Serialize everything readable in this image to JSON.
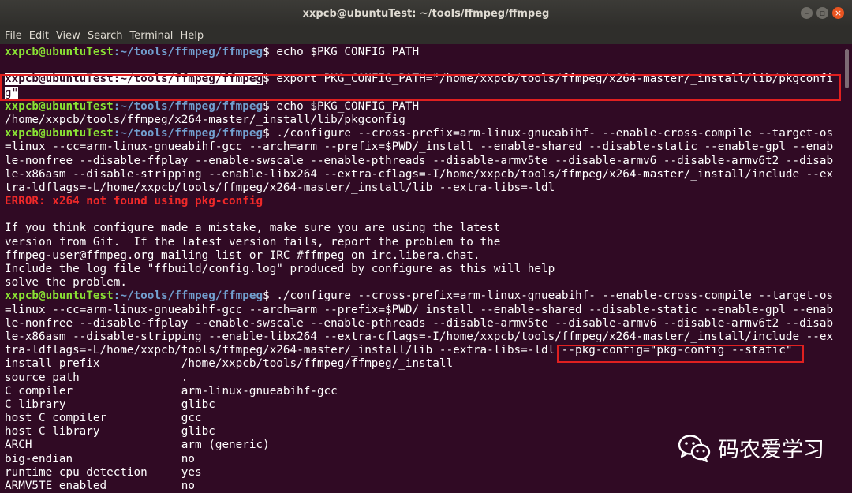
{
  "window": {
    "title": "xxpcb@ubuntuTest: ~/tools/ffmpeg/ffmpeg"
  },
  "menu": [
    "File",
    "Edit",
    "View",
    "Search",
    "Terminal",
    "Help"
  ],
  "prompt": {
    "user": "xxpcb@ubuntuTest",
    "path": ":~/tools/ffmpeg/ffmpeg"
  },
  "lines": [
    {
      "type": "cmd",
      "text": "$ echo $PKG_CONFIG_PATH"
    },
    {
      "type": "blank",
      "text": ""
    },
    {
      "type": "cmd_sel",
      "text": "$ export PKG_CONFIG_PATH=\"/home/xxpcb/tools/ffmpeg/x264-master/_install/lib/pkgconfi"
    },
    {
      "type": "sel",
      "text": "g\""
    },
    {
      "type": "cmd",
      "text": "$ echo $PKG_CONFIG_PATH"
    },
    {
      "type": "out",
      "text": "/home/xxpcb/tools/ffmpeg/x264-master/_install/lib/pkgconfig"
    },
    {
      "type": "cmd",
      "text": "$ ./configure --cross-prefix=arm-linux-gnueabihf- --enable-cross-compile --target-os"
    },
    {
      "type": "out",
      "text": "=linux --cc=arm-linux-gnueabihf-gcc --arch=arm --prefix=$PWD/_install --enable-shared --disable-static --enable-gpl --enab"
    },
    {
      "type": "out",
      "text": "le-nonfree --disable-ffplay --enable-swscale --enable-pthreads --disable-armv5te --disable-armv6 --disable-armv6t2 --disab"
    },
    {
      "type": "out",
      "text": "le-x86asm --disable-stripping --enable-libx264 --extra-cflags=-I/home/xxpcb/tools/ffmpeg/x264-master/_install/include --ex"
    },
    {
      "type": "out",
      "text": "tra-ldflags=-L/home/xxpcb/tools/ffmpeg/x264-master/_install/lib --extra-libs=-ldl"
    },
    {
      "type": "err",
      "text": "ERROR: x264 not found using pkg-config"
    },
    {
      "type": "blank",
      "text": ""
    },
    {
      "type": "out",
      "text": "If you think configure made a mistake, make sure you are using the latest"
    },
    {
      "type": "out",
      "text": "version from Git.  If the latest version fails, report the problem to the"
    },
    {
      "type": "out",
      "text": "ffmpeg-user@ffmpeg.org mailing list or IRC #ffmpeg on irc.libera.chat."
    },
    {
      "type": "out",
      "text": "Include the log file \"ffbuild/config.log\" produced by configure as this will help"
    },
    {
      "type": "out",
      "text": "solve the problem."
    },
    {
      "type": "cmd",
      "text": "$ ./configure --cross-prefix=arm-linux-gnueabihf- --enable-cross-compile --target-os"
    },
    {
      "type": "out",
      "text": "=linux --cc=arm-linux-gnueabihf-gcc --arch=arm --prefix=$PWD/_install --enable-shared --disable-static --enable-gpl --enab"
    },
    {
      "type": "out",
      "text": "le-nonfree --disable-ffplay --enable-swscale --enable-pthreads --disable-armv5te --disable-armv6 --disable-armv6t2 --disab"
    },
    {
      "type": "out",
      "text": "le-x86asm --disable-stripping --enable-libx264 --extra-cflags=-I/home/xxpcb/tools/ffmpeg/x264-master/_install/include --ex"
    },
    {
      "type": "out",
      "text": "tra-ldflags=-L/home/xxpcb/tools/ffmpeg/x264-master/_install/lib --extra-libs=-ldl --pkg-config=\"pkg-config --static\""
    },
    {
      "type": "out",
      "text": "install prefix            /home/xxpcb/tools/ffmpeg/ffmpeg/_install"
    },
    {
      "type": "out",
      "text": "source path               ."
    },
    {
      "type": "out",
      "text": "C compiler                arm-linux-gnueabihf-gcc"
    },
    {
      "type": "out",
      "text": "C library                 glibc"
    },
    {
      "type": "out",
      "text": "host C compiler           gcc"
    },
    {
      "type": "out",
      "text": "host C library            glibc"
    },
    {
      "type": "out",
      "text": "ARCH                      arm (generic)"
    },
    {
      "type": "out",
      "text": "big-endian                no"
    },
    {
      "type": "out",
      "text": "runtime cpu detection     yes"
    },
    {
      "type": "out",
      "text": "ARMV5TE enabled           no"
    }
  ],
  "watermark": {
    "text": "码农爱学习",
    "icon": "wechat-icon"
  },
  "colors": {
    "background": "#300a24",
    "user": "#8ae234",
    "path": "#729fcf",
    "error": "#ef2929",
    "highlight": "#e02020"
  }
}
